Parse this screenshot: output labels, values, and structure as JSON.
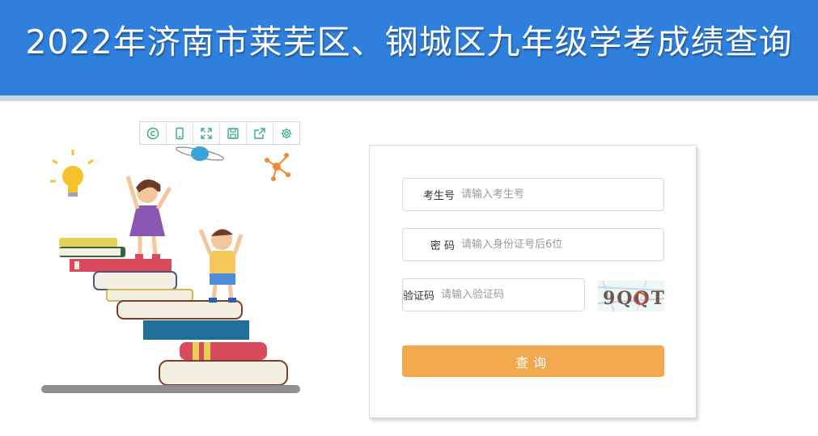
{
  "header": {
    "title": "2022年济南市莱芜区、钢城区九年级学考成绩查询"
  },
  "toolbar": {
    "items": [
      {
        "icon": "copyright-icon"
      },
      {
        "icon": "mobile-icon"
      },
      {
        "icon": "fullscreen-icon"
      },
      {
        "icon": "save-icon"
      },
      {
        "icon": "share-icon"
      },
      {
        "icon": "gear-icon"
      }
    ]
  },
  "form": {
    "exam_id": {
      "label": "考生号",
      "placeholder": "请输入考生号",
      "value": ""
    },
    "password": {
      "label": "密 码",
      "placeholder": "请输入身份证号后6位",
      "value": ""
    },
    "captcha": {
      "label": "验证码",
      "placeholder": "请输入验证码",
      "value": "",
      "image_text": "9QQT"
    },
    "submit_label": "查询"
  },
  "colors": {
    "header_bg": "#2f7fdc",
    "button_bg": "#f2a94e",
    "icon_color": "#2fae74"
  }
}
